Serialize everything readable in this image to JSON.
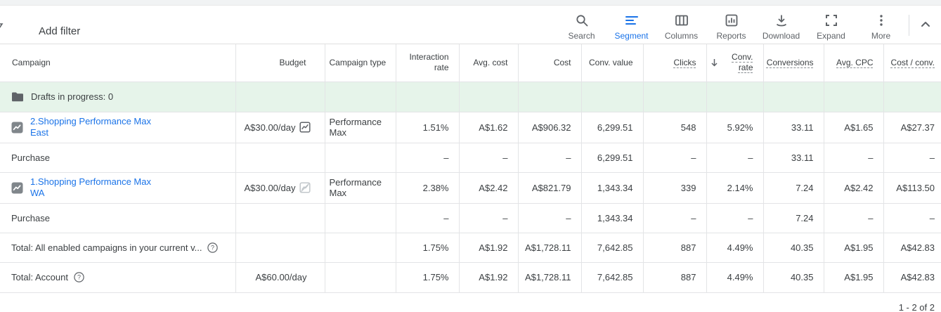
{
  "toolbar": {
    "add_filter_label": "Add filter",
    "actions": [
      {
        "label": "Search",
        "icon": "search-icon",
        "active": false
      },
      {
        "label": "Segment",
        "icon": "segment-icon",
        "active": true
      },
      {
        "label": "Columns",
        "icon": "columns-icon",
        "active": false
      },
      {
        "label": "Reports",
        "icon": "reports-icon",
        "active": false
      },
      {
        "label": "Download",
        "icon": "download-icon",
        "active": false
      },
      {
        "label": "Expand",
        "icon": "expand-icon",
        "active": false
      },
      {
        "label": "More",
        "icon": "more-icon",
        "active": false
      }
    ]
  },
  "table": {
    "columns": [
      {
        "label": "Campaign"
      },
      {
        "label": "Budget"
      },
      {
        "label": "Campaign type"
      },
      {
        "label": "Interaction rate"
      },
      {
        "label": "Avg. cost"
      },
      {
        "label": "Cost"
      },
      {
        "label": "Conv. value"
      },
      {
        "label": "Clicks",
        "tooltip_underline": true
      },
      {
        "label": "Conv. rate",
        "tooltip_underline": true,
        "sorted": true
      },
      {
        "label": "Conversions",
        "tooltip_underline": true
      },
      {
        "label": "Avg. CPC",
        "tooltip_underline": true
      },
      {
        "label": "Cost / conv.",
        "tooltip_underline": true
      }
    ],
    "sort": {
      "column": "Conv. rate",
      "direction": "descending"
    },
    "rows": [
      {
        "type": "drafts",
        "name": "Drafts in progress: 0",
        "metrics": [
          "",
          "",
          "",
          "",
          "",
          "",
          "",
          "",
          ""
        ]
      },
      {
        "type": "campaign",
        "name": "2.Shopping Performance Max East",
        "budget": "A$30.00/day",
        "campaign_type": "Performance Max",
        "metrics": [
          "1.51%",
          "A$1.62",
          "A$906.32",
          "6,299.51",
          "548",
          "5.92%",
          "33.11",
          "A$1.65",
          "A$27.37"
        ]
      },
      {
        "type": "segment",
        "name": "Purchase",
        "metrics": [
          "–",
          "–",
          "–",
          "6,299.51",
          "–",
          "–",
          "33.11",
          "–",
          "–"
        ]
      },
      {
        "type": "campaign",
        "name": "1.Shopping Performance Max WA",
        "budget": "A$30.00/day",
        "campaign_type": "Performance Max",
        "metrics": [
          "2.38%",
          "A$2.42",
          "A$821.79",
          "1,343.34",
          "339",
          "2.14%",
          "7.24",
          "A$2.42",
          "A$113.50"
        ]
      },
      {
        "type": "segment",
        "name": "Purchase",
        "metrics": [
          "–",
          "–",
          "–",
          "1,343.34",
          "–",
          "–",
          "7.24",
          "–",
          "–"
        ]
      },
      {
        "type": "total",
        "name": "Total: All enabled campaigns in your current v...",
        "metrics": [
          "1.75%",
          "A$1.92",
          "A$1,728.11",
          "7,642.85",
          "887",
          "4.49%",
          "40.35",
          "A$1.95",
          "A$42.83"
        ]
      },
      {
        "type": "total",
        "name": "Total: Account",
        "budget": "A$60.00/day",
        "metrics": [
          "1.75%",
          "A$1.92",
          "A$1,728.11",
          "7,642.85",
          "887",
          "4.49%",
          "40.35",
          "A$1.95",
          "A$42.83"
        ]
      }
    ]
  },
  "pagination": {
    "label": "1 - 2 of 2"
  },
  "colors": {
    "accent_blue": "#1a73e8",
    "drafts_row_bg": "#e6f4ea",
    "text_primary": "#3c4043",
    "text_secondary": "#5f6368",
    "border": "#e3e4e6"
  }
}
